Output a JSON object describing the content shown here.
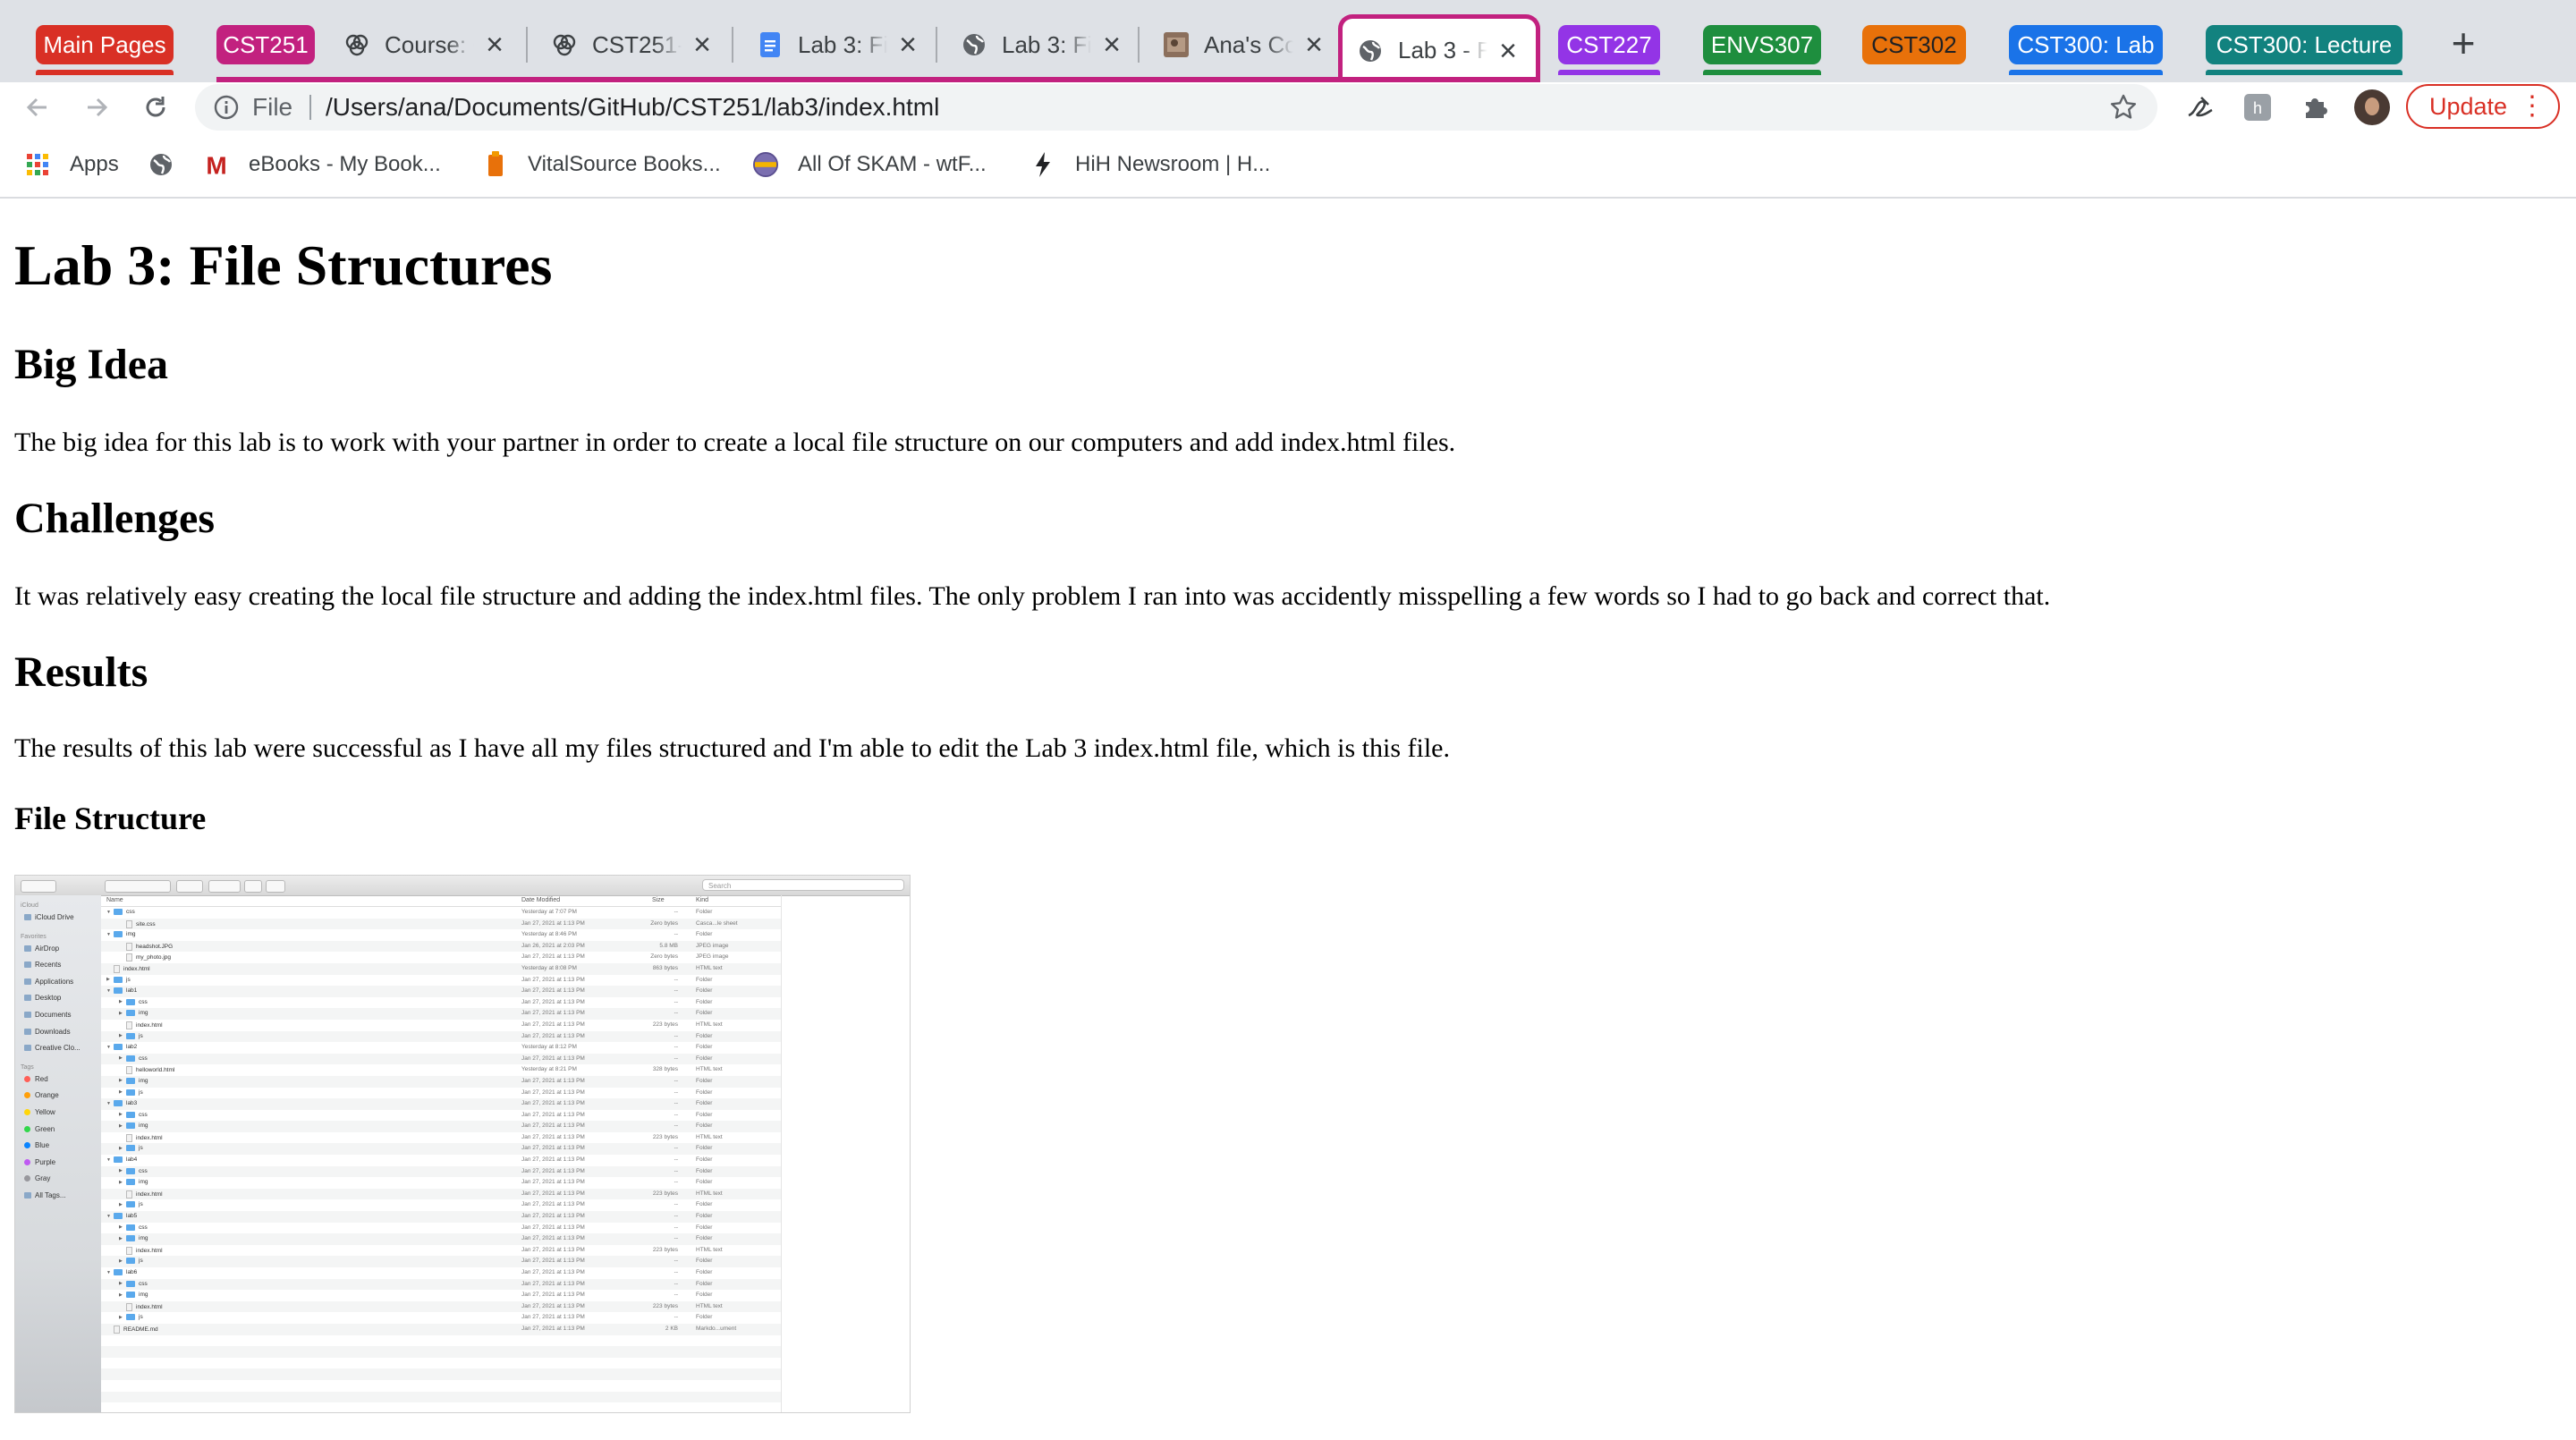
{
  "tabstrip": {
    "groups": [
      {
        "label": "Main Pages",
        "color": "#d93025"
      },
      {
        "label": "CST251",
        "color": "#c2217f"
      },
      {
        "label": "CST227",
        "color": "#9334e6"
      },
      {
        "label": "ENVS307",
        "color": "#1e8e3e"
      },
      {
        "label": "CST302",
        "color": "#e8710a"
      },
      {
        "label": "CST300: Lab",
        "color": "#1a73e8"
      },
      {
        "label": "CST300: Lecture",
        "color": "#12827f"
      }
    ],
    "tabs": [
      {
        "title": "Course: C",
        "icon": "brain-icon"
      },
      {
        "title": "CST251-",
        "icon": "brain-icon"
      },
      {
        "title": "Lab 3: Fi",
        "icon": "docs-icon"
      },
      {
        "title": "Lab 3: Fi",
        "icon": "globe-icon"
      },
      {
        "title": "Ana's Co",
        "icon": "thumbnail-icon"
      },
      {
        "title": "Lab 3 - F",
        "icon": "globe-icon",
        "active": true
      }
    ]
  },
  "toolbar": {
    "scheme_label": "File",
    "url": "/Users/ana/Documents/GitHub/CST251/lab3/index.html",
    "update_label": "Update"
  },
  "bookmarks": [
    {
      "label": "Apps",
      "icon": "apps-grid-icon"
    },
    {
      "label": "",
      "icon": "globe-icon"
    },
    {
      "label": "eBooks - My Book...",
      "icon": "m-logo-icon"
    },
    {
      "label": "VitalSource Books...",
      "icon": "vitalsource-icon"
    },
    {
      "label": "All Of SKAM - wtF...",
      "icon": "skam-icon"
    },
    {
      "label": "HiH Newsroom | H...",
      "icon": "bolt-icon"
    }
  ],
  "page": {
    "title": "Lab 3: File Structures",
    "sections": [
      {
        "heading": "Big Idea",
        "text": "The big idea for this lab is to work with your partner in order to create a local file structure on our computers and add index.html files."
      },
      {
        "heading": "Challenges",
        "text": "It was relatively easy creating the local file structure and adding the index.html files. The only problem I ran into was accidently misspelling a few words so I had to go back and correct that."
      },
      {
        "heading": "Results",
        "text": "The results of this lab were successful as I have all my files structured and I'm able to edit the Lab 3 index.html file, which is this file."
      }
    ],
    "subheading": "File Structure"
  },
  "finder": {
    "search_placeholder": "Search",
    "columns": {
      "name": "Name",
      "date": "Date Modified",
      "size": "Size",
      "kind": "Kind"
    },
    "sidebar": [
      {
        "type": "header",
        "label": "iCloud"
      },
      {
        "type": "item",
        "label": "iCloud Drive"
      },
      {
        "type": "header",
        "label": "Favorites"
      },
      {
        "type": "item",
        "label": "AirDrop"
      },
      {
        "type": "item",
        "label": "Recents"
      },
      {
        "type": "item",
        "label": "Applications"
      },
      {
        "type": "item",
        "label": "Desktop"
      },
      {
        "type": "item",
        "label": "Documents"
      },
      {
        "type": "item",
        "label": "Downloads"
      },
      {
        "type": "item",
        "label": "Creative Clo..."
      },
      {
        "type": "header",
        "label": "Tags"
      },
      {
        "type": "tag",
        "label": "Red",
        "color": "#ff5f57"
      },
      {
        "type": "tag",
        "label": "Orange",
        "color": "#ff9f0a"
      },
      {
        "type": "tag",
        "label": "Yellow",
        "color": "#ffd60a"
      },
      {
        "type": "tag",
        "label": "Green",
        "color": "#32d74b"
      },
      {
        "type": "tag",
        "label": "Blue",
        "color": "#0a84ff"
      },
      {
        "type": "tag",
        "label": "Purple",
        "color": "#bf5af2"
      },
      {
        "type": "tag",
        "label": "Gray",
        "color": "#98989d"
      },
      {
        "type": "item",
        "label": "All Tags..."
      }
    ],
    "rows": [
      {
        "name": "css",
        "depth": 0,
        "kind": "Folder",
        "date": "Yesterday at 7:07 PM",
        "size": "--",
        "expanded": true
      },
      {
        "name": "site.css",
        "depth": 1,
        "kind": "Casca...le sheet",
        "date": "Jan 27, 2021 at 1:13 PM",
        "size": "Zero bytes",
        "file": true
      },
      {
        "name": "img",
        "depth": 0,
        "kind": "Folder",
        "date": "Yesterday at 8:46 PM",
        "size": "--",
        "expanded": true
      },
      {
        "name": "headshot.JPG",
        "depth": 1,
        "kind": "JPEG image",
        "date": "Jan 26, 2021 at 2:03 PM",
        "size": "5.8 MB",
        "file": true
      },
      {
        "name": "my_photo.jpg",
        "depth": 1,
        "kind": "JPEG image",
        "date": "Jan 27, 2021 at 1:13 PM",
        "size": "Zero bytes",
        "file": true
      },
      {
        "name": "index.html",
        "depth": 0,
        "kind": "HTML text",
        "date": "Yesterday at 8:08 PM",
        "size": "863 bytes",
        "file": true
      },
      {
        "name": "js",
        "depth": 0,
        "kind": "Folder",
        "date": "Jan 27, 2021 at 1:13 PM",
        "size": "--"
      },
      {
        "name": "lab1",
        "depth": 0,
        "kind": "Folder",
        "date": "Jan 27, 2021 at 1:13 PM",
        "size": "--",
        "expanded": true
      },
      {
        "name": "css",
        "depth": 1,
        "kind": "Folder",
        "date": "Jan 27, 2021 at 1:13 PM",
        "size": "--"
      },
      {
        "name": "img",
        "depth": 1,
        "kind": "Folder",
        "date": "Jan 27, 2021 at 1:13 PM",
        "size": "--"
      },
      {
        "name": "index.html",
        "depth": 1,
        "kind": "HTML text",
        "date": "Jan 27, 2021 at 1:13 PM",
        "size": "223 bytes",
        "file": true
      },
      {
        "name": "js",
        "depth": 1,
        "kind": "Folder",
        "date": "Jan 27, 2021 at 1:13 PM",
        "size": "--"
      },
      {
        "name": "lab2",
        "depth": 0,
        "kind": "Folder",
        "date": "Yesterday at 8:12 PM",
        "size": "--",
        "expanded": true
      },
      {
        "name": "css",
        "depth": 1,
        "kind": "Folder",
        "date": "Jan 27, 2021 at 1:13 PM",
        "size": "--"
      },
      {
        "name": "helloworld.html",
        "depth": 1,
        "kind": "HTML text",
        "date": "Yesterday at 8:21 PM",
        "size": "328 bytes",
        "file": true
      },
      {
        "name": "img",
        "depth": 1,
        "kind": "Folder",
        "date": "Jan 27, 2021 at 1:13 PM",
        "size": "--"
      },
      {
        "name": "js",
        "depth": 1,
        "kind": "Folder",
        "date": "Jan 27, 2021 at 1:13 PM",
        "size": "--"
      },
      {
        "name": "lab3",
        "depth": 0,
        "kind": "Folder",
        "date": "Jan 27, 2021 at 1:13 PM",
        "size": "--",
        "expanded": true
      },
      {
        "name": "css",
        "depth": 1,
        "kind": "Folder",
        "date": "Jan 27, 2021 at 1:13 PM",
        "size": "--"
      },
      {
        "name": "img",
        "depth": 1,
        "kind": "Folder",
        "date": "Jan 27, 2021 at 1:13 PM",
        "size": "--"
      },
      {
        "name": "index.html",
        "depth": 1,
        "kind": "HTML text",
        "date": "Jan 27, 2021 at 1:13 PM",
        "size": "223 bytes",
        "file": true
      },
      {
        "name": "js",
        "depth": 1,
        "kind": "Folder",
        "date": "Jan 27, 2021 at 1:13 PM",
        "size": "--"
      },
      {
        "name": "lab4",
        "depth": 0,
        "kind": "Folder",
        "date": "Jan 27, 2021 at 1:13 PM",
        "size": "--",
        "expanded": true
      },
      {
        "name": "css",
        "depth": 1,
        "kind": "Folder",
        "date": "Jan 27, 2021 at 1:13 PM",
        "size": "--"
      },
      {
        "name": "img",
        "depth": 1,
        "kind": "Folder",
        "date": "Jan 27, 2021 at 1:13 PM",
        "size": "--"
      },
      {
        "name": "index.html",
        "depth": 1,
        "kind": "HTML text",
        "date": "Jan 27, 2021 at 1:13 PM",
        "size": "223 bytes",
        "file": true
      },
      {
        "name": "js",
        "depth": 1,
        "kind": "Folder",
        "date": "Jan 27, 2021 at 1:13 PM",
        "size": "--"
      },
      {
        "name": "lab5",
        "depth": 0,
        "kind": "Folder",
        "date": "Jan 27, 2021 at 1:13 PM",
        "size": "--",
        "expanded": true
      },
      {
        "name": "css",
        "depth": 1,
        "kind": "Folder",
        "date": "Jan 27, 2021 at 1:13 PM",
        "size": "--"
      },
      {
        "name": "img",
        "depth": 1,
        "kind": "Folder",
        "date": "Jan 27, 2021 at 1:13 PM",
        "size": "--"
      },
      {
        "name": "index.html",
        "depth": 1,
        "kind": "HTML text",
        "date": "Jan 27, 2021 at 1:13 PM",
        "size": "223 bytes",
        "file": true
      },
      {
        "name": "js",
        "depth": 1,
        "kind": "Folder",
        "date": "Jan 27, 2021 at 1:13 PM",
        "size": "--"
      },
      {
        "name": "lab6",
        "depth": 0,
        "kind": "Folder",
        "date": "Jan 27, 2021 at 1:13 PM",
        "size": "--",
        "expanded": true
      },
      {
        "name": "css",
        "depth": 1,
        "kind": "Folder",
        "date": "Jan 27, 2021 at 1:13 PM",
        "size": "--"
      },
      {
        "name": "img",
        "depth": 1,
        "kind": "Folder",
        "date": "Jan 27, 2021 at 1:13 PM",
        "size": "--"
      },
      {
        "name": "index.html",
        "depth": 1,
        "kind": "HTML text",
        "date": "Jan 27, 2021 at 1:13 PM",
        "size": "223 bytes",
        "file": true
      },
      {
        "name": "js",
        "depth": 1,
        "kind": "Folder",
        "date": "Jan 27, 2021 at 1:13 PM",
        "size": "--"
      },
      {
        "name": "README.md",
        "depth": 0,
        "kind": "Markdo...ument",
        "date": "Jan 27, 2021 at 1:13 PM",
        "size": "2 KB",
        "file": true
      }
    ]
  }
}
